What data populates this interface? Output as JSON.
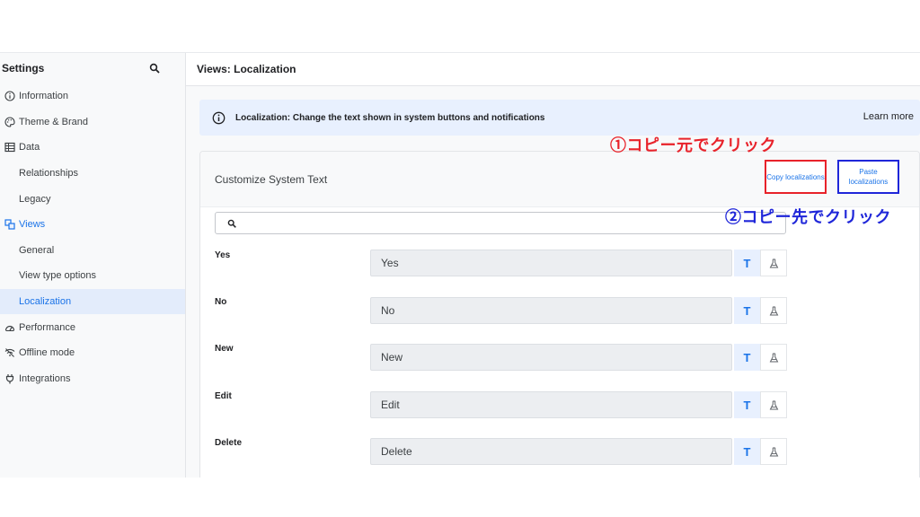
{
  "sidebar": {
    "title": "Settings",
    "items": [
      {
        "label": "Information",
        "icon": "info-icon",
        "level": 0
      },
      {
        "label": "Theme & Brand",
        "icon": "palette-icon",
        "level": 0
      },
      {
        "label": "Data",
        "icon": "table-icon",
        "level": 0
      },
      {
        "label": "Relationships",
        "level": 1
      },
      {
        "label": "Legacy",
        "level": 1
      },
      {
        "label": "Views",
        "icon": "views-icon",
        "level": 0,
        "accent": true
      },
      {
        "label": "General",
        "level": 1
      },
      {
        "label": "View type options",
        "level": 1
      },
      {
        "label": "Localization",
        "level": 1,
        "active": true
      },
      {
        "label": "Performance",
        "icon": "gauge-icon",
        "level": 0
      },
      {
        "label": "Offline mode",
        "icon": "wifi-off-icon",
        "level": 0
      },
      {
        "label": "Integrations",
        "icon": "plug-icon",
        "level": 0
      }
    ]
  },
  "header": {
    "title": "Views: Localization"
  },
  "banner": {
    "text": "Localization: Change the text shown in system buttons and notifications",
    "learn_more": "Learn more"
  },
  "card": {
    "title": "Customize System Text",
    "copy_label": "Copy localizations",
    "paste_label": "Paste localizations",
    "search_placeholder": "",
    "rows": [
      {
        "label": "Yes",
        "value": "Yes"
      },
      {
        "label": "No",
        "value": "No"
      },
      {
        "label": "New",
        "value": "New"
      },
      {
        "label": "Edit",
        "value": "Edit"
      },
      {
        "label": "Delete",
        "value": "Delete"
      }
    ],
    "text_button_glyph": "T"
  },
  "annotations": {
    "copy_source": "①コピー元でクリック",
    "paste_target": "②コピー先でクリック"
  },
  "colors": {
    "accent": "#1a73e8",
    "active_bg": "#e3ecfb",
    "banner_bg": "#e8f0fe",
    "annot_red": "#e8222a",
    "annot_blue": "#1f26d9"
  }
}
